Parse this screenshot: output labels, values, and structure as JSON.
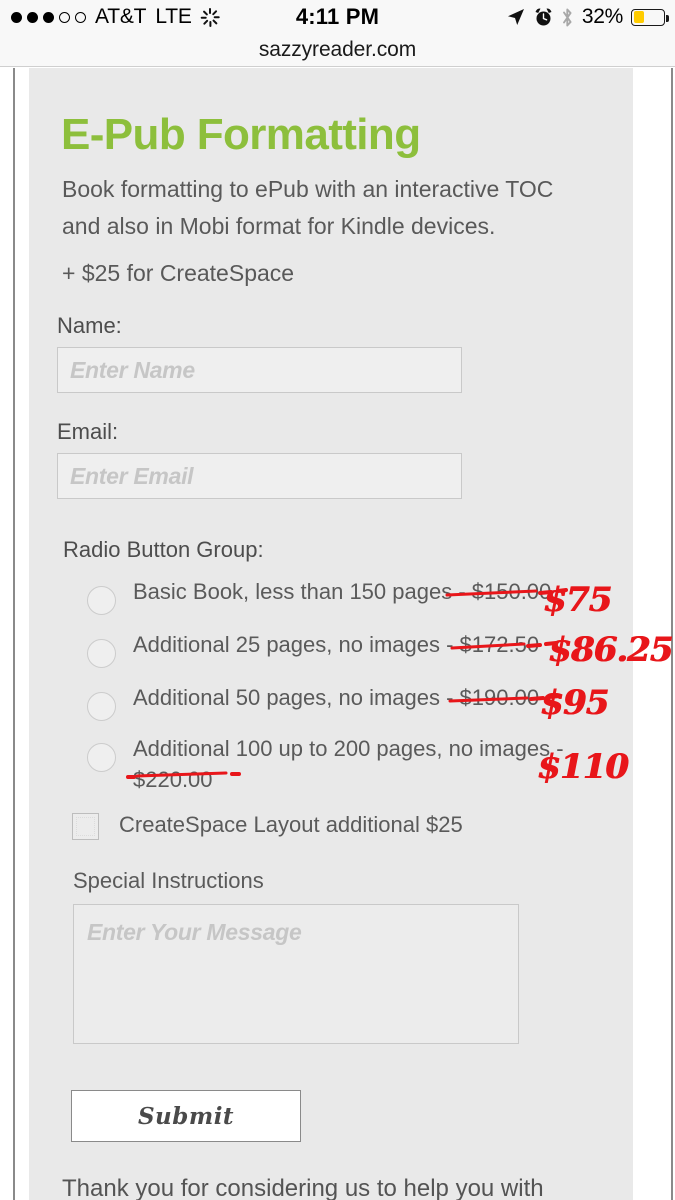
{
  "statusbar": {
    "carrier": "AT&T",
    "network": "LTE",
    "time": "4:11 PM",
    "battery_percent": "32%",
    "signal_filled": 3,
    "signal_total": 5,
    "icons": [
      "location-arrow-icon",
      "alarm-clock-icon",
      "bluetooth-icon",
      "battery-icon"
    ]
  },
  "browser": {
    "url": "sazzyreader.com"
  },
  "page": {
    "title": "E-Pub Formatting",
    "lede": "Book formatting to ePub with an interactive TOC and also in Mobi format for Kindle devices.",
    "addon": "+ $25 for CreateSpace",
    "name_label": "Name:",
    "name_placeholder": "Enter Name",
    "email_label": "Email:",
    "email_placeholder": "Enter Email",
    "radio_group_label": "Radio Button Group:",
    "options": [
      {
        "label": "Basic Book, less than 150 pages - $150.00",
        "old_price": "$150.00",
        "new_price": "$75"
      },
      {
        "label": "Additional 25 pages, no images - $172.50",
        "old_price": "$172.50",
        "new_price": "$86.25"
      },
      {
        "label": "Additional 50 pages, no images - $190.00",
        "old_price": "$190.00",
        "new_price": "$95"
      },
      {
        "label": "Additional 100 up to 200 pages, no images - $220.00",
        "old_price": "$220.00",
        "new_price": "$110"
      }
    ],
    "checkbox_label": "CreateSpace Layout additional $25",
    "special_instructions_label": "Special Instructions",
    "message_placeholder": "Enter Your Message",
    "submit_label": "Submit",
    "footer_text": "Thank you for considering us to help you with"
  },
  "colors": {
    "title_green": "#8dbf3c",
    "markup_red": "#e8161a",
    "panel_bg": "#e9e9e9",
    "battery_yellow": "#ffcc00"
  }
}
